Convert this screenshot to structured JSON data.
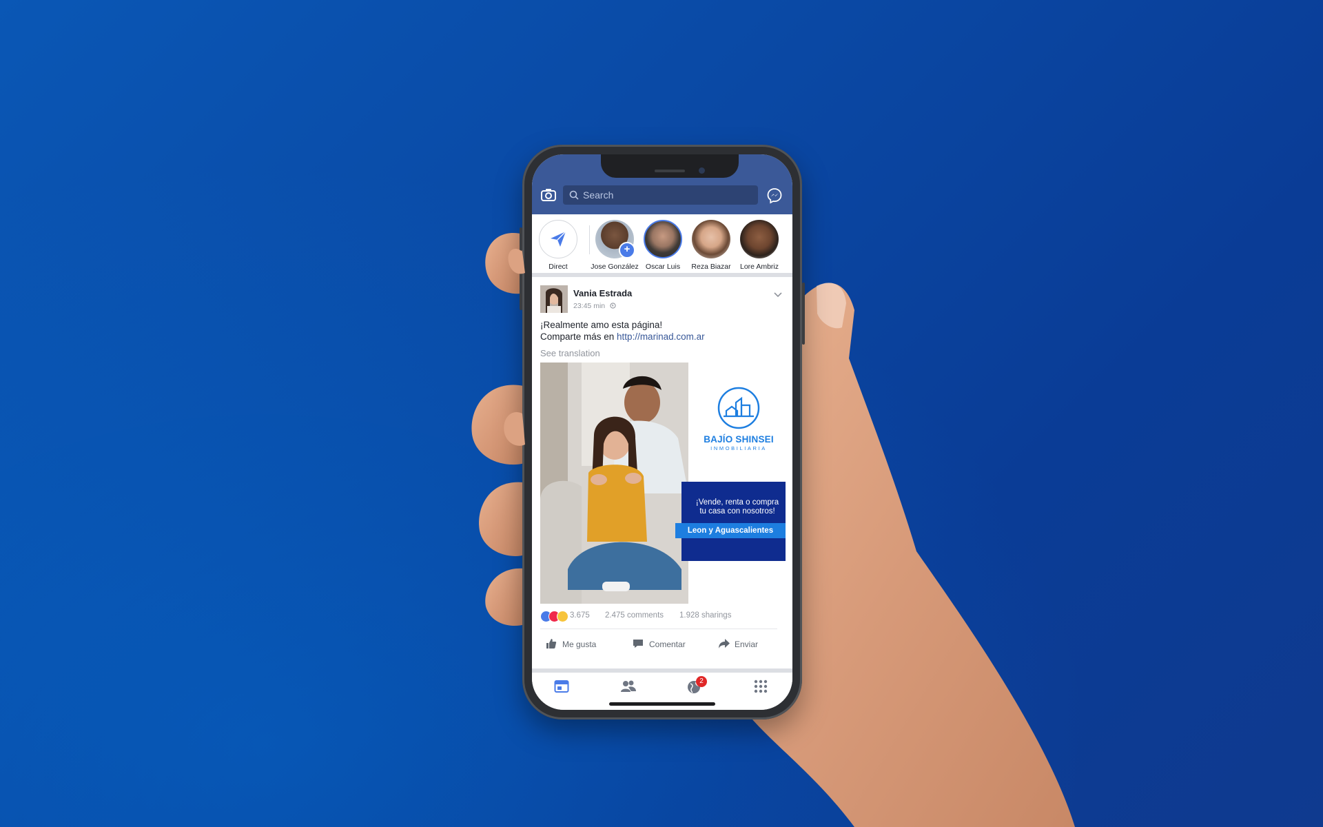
{
  "search": {
    "placeholder": "Search"
  },
  "stories": [
    {
      "name": "Direct"
    },
    {
      "name": "Jose González"
    },
    {
      "name": "Oscar Luis"
    },
    {
      "name": "Reza Biazar"
    },
    {
      "name": "Lore Ambriz"
    }
  ],
  "post": {
    "author": "Vania Estrada",
    "time": "23:45 min",
    "text_line1": "¡Realmente amo esta página!",
    "text_line2_prefix": "Comparte más en ",
    "link": "http://marinad.com.ar",
    "see_translation": "See translation",
    "ad": {
      "brand": "BAJÍO SHINSEI",
      "brand_sub": "INMOBILIARIA",
      "cta_line1": "¡Vende, renta o compra",
      "cta_line2": "tu casa con nosotros!",
      "cta_location": "Leon y Aguascalientes"
    },
    "reaction_count": "3.675",
    "comments": "2.475 comments",
    "sharings": "1.928 sharings",
    "actions": {
      "like": "Me gusta",
      "comment": "Comentar",
      "send": "Enviar"
    }
  },
  "nav": {
    "notification_badge": "2"
  },
  "colors": {
    "facebook_blue": "#3b5998",
    "background": "#0a4aa6",
    "accent": "#1d7ee0",
    "band": "#0f2c8f"
  },
  "icons": [
    "camera-icon",
    "search-icon",
    "messenger-icon",
    "direct-send-icon",
    "add-story-icon",
    "chevron-down-icon",
    "globe-icon",
    "like-icon",
    "comment-icon",
    "share-icon",
    "newsfeed-icon",
    "friends-icon",
    "notifications-globe-icon",
    "menu-grid-icon"
  ]
}
